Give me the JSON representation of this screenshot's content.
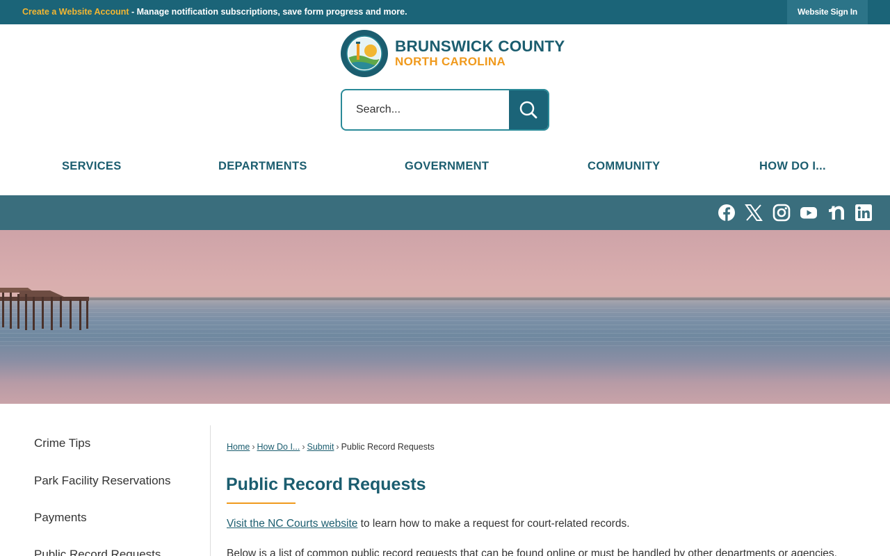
{
  "topbar": {
    "account_link": "Create a Website Account",
    "message": " - Manage notification subscriptions, save form progress and more.",
    "signin_label": "Website Sign In"
  },
  "logo": {
    "line1": "BRUNSWICK COUNTY",
    "line2": "NORTH CAROLINA",
    "seal_text_top": "BRUNSWICK COUNTY",
    "seal_text_bottom": "NORTH CAROLINA"
  },
  "search": {
    "placeholder": "Search..."
  },
  "nav": [
    "SERVICES",
    "DEPARTMENTS",
    "GOVERNMENT",
    "COMMUNITY",
    "HOW DO I..."
  ],
  "social": [
    "facebook-icon",
    "x-icon",
    "instagram-icon",
    "youtube-icon",
    "nextdoor-icon",
    "linkedin-icon"
  ],
  "sidebar": [
    "Crime Tips",
    "Park Facility Reservations",
    "Payments",
    "Public Record Requests"
  ],
  "breadcrumb": [
    "Home",
    "How Do I...",
    "Submit",
    "Public Record Requests"
  ],
  "content": {
    "title": "Public Record Requests",
    "p1_link": "Visit the NC Courts website",
    "p1_text": " to learn how to make a request for court-related records.",
    "p2": "Below is a list of common public record requests that can be found online or must be handled by other departments or agencies."
  },
  "colors": {
    "primary": "#1b6478",
    "accent": "#f09a1d",
    "link": "#1b5d6f"
  }
}
